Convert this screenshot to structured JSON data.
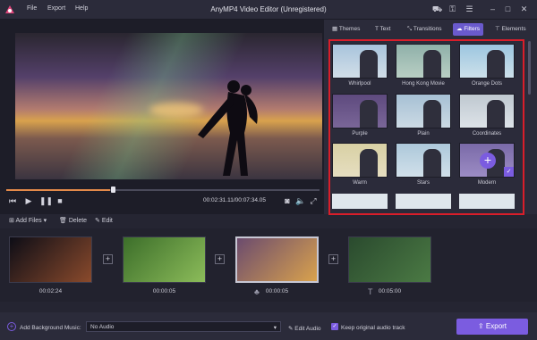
{
  "window": {
    "title": "AnyMP4 Video Editor (Unregistered)",
    "menu": [
      "File",
      "Export",
      "Help"
    ]
  },
  "player": {
    "timecode": "00:02:31.11/00:07:34.05",
    "progress_fraction": 0.33
  },
  "tabs": [
    {
      "label": "Themes",
      "icon": "themes-icon"
    },
    {
      "label": "Text",
      "icon": "text-icon"
    },
    {
      "label": "Transitions",
      "icon": "transitions-icon"
    },
    {
      "label": "Filters",
      "icon": "filters-icon",
      "active": true
    },
    {
      "label": "Elements",
      "icon": "elements-icon"
    }
  ],
  "filters": [
    {
      "label": "Whirlpool",
      "top": "#a8c4dc",
      "bottom": "#d2dee8"
    },
    {
      "label": "Hong Kong Movie",
      "top": "#8fb0a9",
      "bottom": "#b9cfc4"
    },
    {
      "label": "Orange Dots",
      "top": "#9cc6e0",
      "bottom": "#cde0ea"
    },
    {
      "label": "Purple",
      "top": "#5e4a7e",
      "bottom": "#7a6698"
    },
    {
      "label": "Plain",
      "top": "#a6c0d4",
      "bottom": "#ccdae4"
    },
    {
      "label": "Coordinates",
      "top": "#bfc8d0",
      "bottom": "#dde3e8"
    },
    {
      "label": "Warm",
      "top": "#d8d0a4",
      "bottom": "#e6dec0"
    },
    {
      "label": "Stars",
      "top": "#adc8da",
      "bottom": "#d1e0ea"
    },
    {
      "label": "Modern",
      "top": "#7a6aa8",
      "bottom": "#9c8cc4"
    }
  ],
  "toolbar": {
    "add_files": "Add Files",
    "delete": "Delete",
    "edit": "Edit"
  },
  "clips": [
    {
      "duration": "00:02:24",
      "colors": [
        "#0d0d16",
        "#8a4a2c"
      ]
    },
    {
      "duration": "00:00:05",
      "colors": [
        "#3c6e2a",
        "#8cbc5a"
      ]
    },
    {
      "duration": "00:00:05",
      "colors": [
        "#6b4b6e",
        "#d9a24d"
      ]
    },
    {
      "duration": "00:05:00",
      "colors": [
        "#2a4a2e",
        "#4b7a44"
      ]
    }
  ],
  "bottom": {
    "bg_music_label": "Add Background Music:",
    "audio_select": "No Audio",
    "edit_audio": "Edit Audio",
    "keep_audio": "Keep original audio track",
    "export": "Export"
  },
  "colors": {
    "accent": "#7b5ce0",
    "highlight_frame": "#d91e2a",
    "progress": "#e48a4a"
  }
}
